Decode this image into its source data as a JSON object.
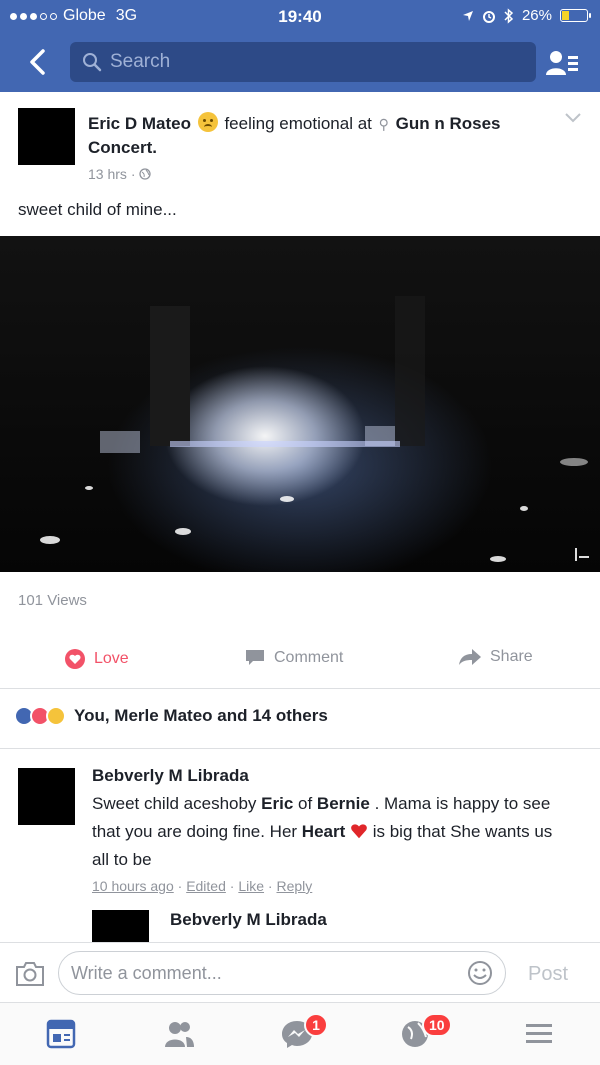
{
  "status_bar": {
    "carrier": "Globe",
    "network": "3G",
    "time": "19:40",
    "battery": "26%",
    "battery_level": 0.26
  },
  "header": {
    "search_placeholder": "Search"
  },
  "post": {
    "author": "Eric D Mateo",
    "feeling": "feeling emotional at",
    "location": "Gun n Roses Concert.",
    "time": "13 hrs",
    "text": "sweet child of mine...",
    "views": "101 Views",
    "actions": {
      "love": "Love",
      "comment": "Comment",
      "share": "Share"
    },
    "reactions_text": "You, Merle Mateo and 14 others"
  },
  "comment": {
    "name": "Bebverly M Librada",
    "text_1": "Sweet child aceshoby ",
    "tag_1": "Eric",
    "text_2": " of ",
    "tag_2": "Bernie",
    "text_3": " . Mama is happy to see that you are doing fine. Her ",
    "tag_3": "Heart",
    "text_4": " is big that She wants us all to be",
    "time": "10 hours ago",
    "edited": "Edited",
    "like": "Like",
    "reply": "Reply"
  },
  "reply": {
    "name": "Bebverly M Librada"
  },
  "composer": {
    "placeholder": "Write a comment...",
    "post_label": "Post"
  },
  "tabbar": {
    "messages_badge": "1",
    "notifications_badge": "10"
  }
}
